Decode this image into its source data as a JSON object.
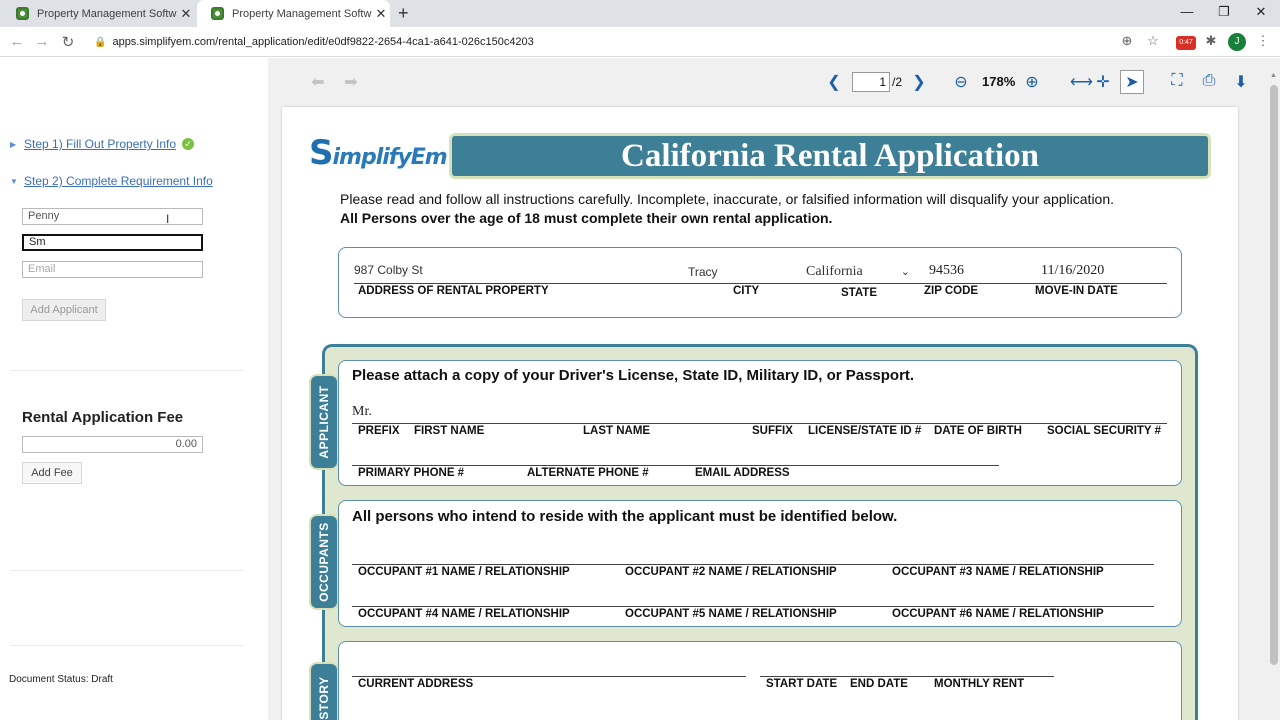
{
  "browser": {
    "tabs": [
      {
        "title": "Property Management Software",
        "active": false
      },
      {
        "title": "Property Management Software",
        "active": true
      }
    ],
    "url": "apps.simplifyem.com/rental_application/edit/e0df9822-2654-4ca1-a641-026c150c4203",
    "extension_badge": "0:47",
    "profile_initial": "J"
  },
  "left_panel": {
    "steps": [
      {
        "label": "Step 1) Fill Out Property Info",
        "complete": true
      },
      {
        "label": "Step 2) Complete Requirement Info",
        "complete": false
      }
    ],
    "applicant_form": {
      "first_name_value": "Penny",
      "last_name_value": "Sm",
      "email_placeholder": "Email",
      "add_applicant_label": "Add Applicant"
    },
    "fee": {
      "title": "Rental Application Fee",
      "value": "0.00",
      "add_fee_label": "Add Fee"
    },
    "document_status": "Document Status: Draft"
  },
  "viewer_toolbar": {
    "current_page": "1",
    "page_total": "/2",
    "zoom": "178%",
    "icons": [
      "undo-icon",
      "redo-icon",
      "prev-page-icon",
      "next-page-icon",
      "zoom-out-icon",
      "zoom-in-icon",
      "fit-width-icon",
      "pan-icon",
      "select-icon",
      "fullscreen-icon",
      "print-icon",
      "download-icon"
    ]
  },
  "document": {
    "logo_text": "implifyEm",
    "logo_initial": "S",
    "title": "California Rental Application",
    "instruction_1": "Please read and follow all instructions carefully. Incomplete, inaccurate, or falsified information will disqualify your application.",
    "instruction_2": "All Persons over the age of 18 must complete their own rental application.",
    "property": {
      "address_value": "987 Colby St",
      "city_value": "Tracy",
      "state_value": "California",
      "zip_value": "94536",
      "move_in_value": "11/16/2020",
      "labels": {
        "address": "ADDRESS OF RENTAL PROPERTY",
        "city": "CITY",
        "state": "STATE",
        "zip": "ZIP CODE",
        "move_in": "MOVE-IN DATE"
      }
    },
    "applicant": {
      "tab": "APPLICANT",
      "heading": "Please attach a copy of your Driver's License, State ID, Military ID, or Passport.",
      "prefix_value": "Mr.",
      "labels_row1": [
        "PREFIX",
        "FIRST NAME",
        "LAST NAME",
        "SUFFIX",
        "LICENSE/STATE ID #",
        "DATE OF BIRTH",
        "SOCIAL SECURITY #"
      ],
      "labels_row2": [
        "PRIMARY PHONE #",
        "ALTERNATE PHONE #",
        "EMAIL ADDRESS"
      ]
    },
    "occupants": {
      "tab": "OCCUPANTS",
      "heading": "All persons who intend to reside with the applicant must be identified below.",
      "labels": [
        "OCCUPANT #1 NAME / RELATIONSHIP",
        "OCCUPANT #2 NAME / RELATIONSHIP",
        "OCCUPANT #3 NAME / RELATIONSHIP",
        "OCCUPANT #4 NAME / RELATIONSHIP",
        "OCCUPANT #5 NAME / RELATIONSHIP",
        "OCCUPANT #6 NAME / RELATIONSHIP"
      ]
    },
    "history": {
      "tab": "STORY",
      "labels": [
        "CURRENT ADDRESS",
        "START DATE",
        "END DATE",
        "MONTHLY RENT"
      ]
    }
  }
}
